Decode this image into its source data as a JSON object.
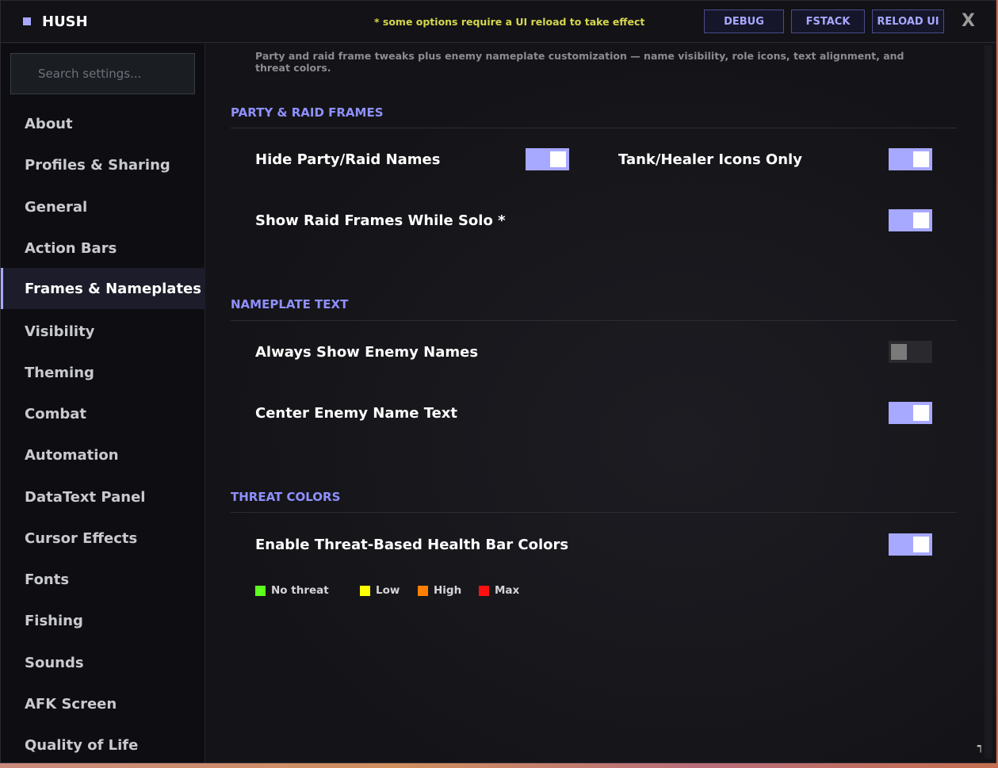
{
  "window": {
    "title": "HUSH",
    "notice": "* some options require a UI reload to take effect",
    "buttons": {
      "debug": "DEBUG",
      "fstack": "FSTACK",
      "reload": "RELOAD UI"
    },
    "close": "X"
  },
  "sidebar": {
    "search_placeholder": "Search settings...",
    "items": [
      {
        "label": "About"
      },
      {
        "label": "Profiles & Sharing"
      },
      {
        "label": "General"
      },
      {
        "label": "Action Bars"
      },
      {
        "label": "Frames & Nameplates",
        "active": true
      },
      {
        "label": "Visibility"
      },
      {
        "label": "Theming"
      },
      {
        "label": "Combat"
      },
      {
        "label": "Automation"
      },
      {
        "label": "DataText Panel"
      },
      {
        "label": "Cursor Effects"
      },
      {
        "label": "Fonts"
      },
      {
        "label": "Fishing"
      },
      {
        "label": "Sounds"
      },
      {
        "label": "AFK Screen"
      },
      {
        "label": "Quality of Life"
      }
    ]
  },
  "content": {
    "description": "Party and raid frame tweaks plus enemy nameplate customization — name visibility, role icons, text alignment, and threat colors.",
    "sections": [
      {
        "title": "PARTY & RAID FRAMES",
        "options": [
          {
            "label": "Hide Party/Raid Names",
            "enabled": true
          },
          {
            "label": "Tank/Healer Icons Only",
            "enabled": true
          },
          {
            "label": "Show Raid Frames While Solo *",
            "enabled": true
          }
        ]
      },
      {
        "title": "NAMEPLATE TEXT",
        "options": [
          {
            "label": "Always Show Enemy Names",
            "enabled": false
          },
          {
            "label": "Center Enemy Name Text",
            "enabled": true
          }
        ]
      },
      {
        "title": "THREAT COLORS",
        "options": [
          {
            "label": "Enable Threat-Based Health Bar Colors",
            "enabled": true
          }
        ],
        "legend": [
          {
            "label": "No threat",
            "color": "#5cff1e"
          },
          {
            "label": "Low",
            "color": "#ffff00"
          },
          {
            "label": "High",
            "color": "#ff8000"
          },
          {
            "label": "Max",
            "color": "#ff1010"
          }
        ]
      }
    ]
  },
  "colors": {
    "accent": "#a7a8ff",
    "section_title": "#8f90ff",
    "notice": "#d6d64d"
  },
  "icons": {
    "resize_grip": "resize-grip-icon"
  }
}
